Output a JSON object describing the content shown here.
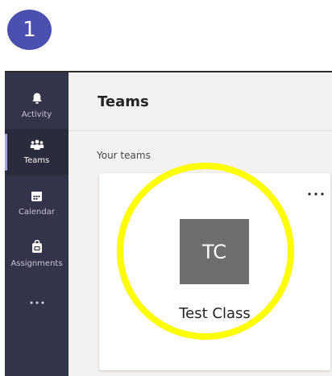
{
  "step_badge": "1",
  "rail": {
    "items": [
      {
        "label": "Activity",
        "icon": "bell-icon",
        "active": false
      },
      {
        "label": "Teams",
        "icon": "teams-icon",
        "active": true
      },
      {
        "label": "Calendar",
        "icon": "calendar-icon",
        "active": false
      },
      {
        "label": "Assignments",
        "icon": "assignments-icon",
        "active": false
      }
    ],
    "more_label": "..."
  },
  "header": {
    "title": "Teams"
  },
  "section": {
    "label": "Your teams"
  },
  "team_card": {
    "initials": "TC",
    "name": "Test Class",
    "more_label": "..."
  },
  "colors": {
    "rail_bg": "#33344a",
    "badge": "#4a4fb0",
    "highlight": "#ffff00",
    "avatar_bg": "#6e6e6e"
  }
}
